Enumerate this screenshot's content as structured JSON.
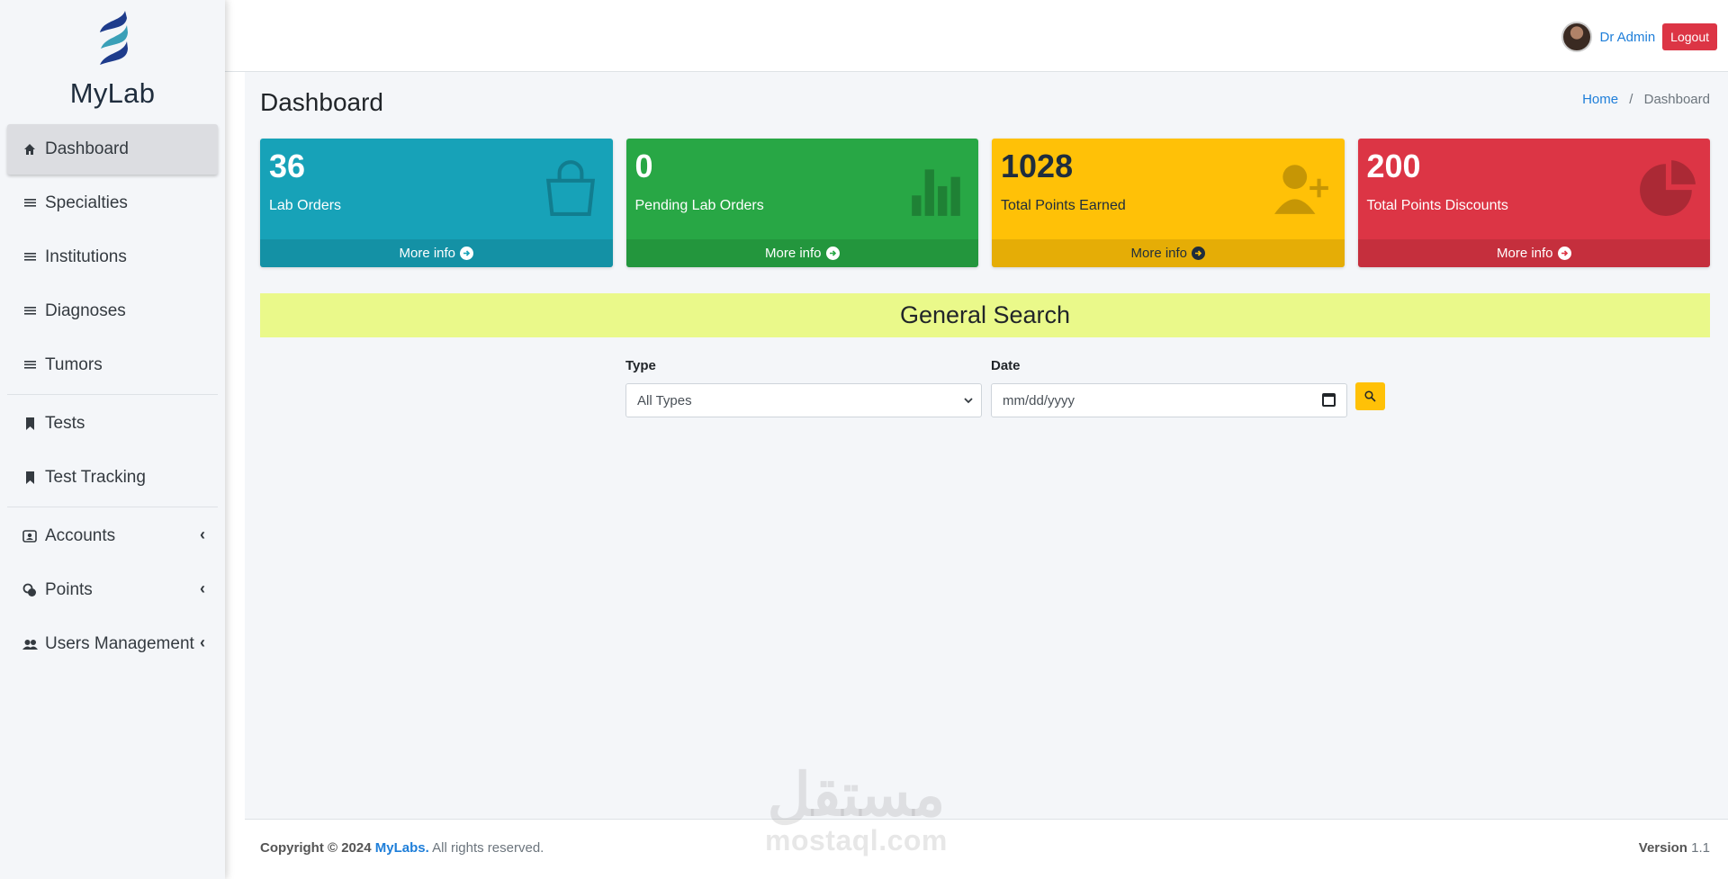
{
  "brand": {
    "name": "MyLab"
  },
  "sidebar": {
    "items": [
      {
        "label": "Dashboard",
        "icon": "home-icon",
        "active": true
      },
      {
        "label": "Specialties",
        "icon": "list-icon"
      },
      {
        "label": "Institutions",
        "icon": "list-icon"
      },
      {
        "label": "Diagnoses",
        "icon": "list-icon"
      },
      {
        "label": "Tumors",
        "icon": "list-icon"
      },
      {
        "label": "Tests",
        "icon": "bookmark-icon"
      },
      {
        "label": "Test Tracking",
        "icon": "bookmark-icon"
      },
      {
        "label": "Accounts",
        "icon": "id-card-icon",
        "expandable": true
      },
      {
        "label": "Points",
        "icon": "coins-icon",
        "expandable": true
      },
      {
        "label": "Users Management",
        "icon": "users-icon",
        "expandable": true
      }
    ]
  },
  "topbar": {
    "user_name": "Dr Admin",
    "logout_label": "Logout"
  },
  "page": {
    "title": "Dashboard"
  },
  "breadcrumb": {
    "home": "Home",
    "separator": "/",
    "current": "Dashboard"
  },
  "stats": [
    {
      "value": "36",
      "label": "Lab Orders",
      "more": "More info",
      "color": "#17a2b8",
      "icon": "shopping-bag-icon"
    },
    {
      "value": "0",
      "label": "Pending Lab Orders",
      "more": "More info",
      "color": "#28a745",
      "icon": "bar-chart-icon"
    },
    {
      "value": "1028",
      "label": "Total Points Earned",
      "more": "More info",
      "color": "#ffc107",
      "icon": "user-plus-icon"
    },
    {
      "value": "200",
      "label": "Total Points Discounts",
      "more": "More info",
      "color": "#dc3545",
      "icon": "pie-chart-icon"
    }
  ],
  "search": {
    "title": "General Search",
    "type_label": "Type",
    "type_value": "All Types",
    "date_label": "Date",
    "date_placeholder": "mm/dd/yyyy"
  },
  "watermark": {
    "arabic": "مستقل",
    "latin": "mostaql.com"
  },
  "footer": {
    "copyright_prefix": "Copyright © 2024",
    "company": "MyLabs.",
    "rights": "All rights reserved.",
    "version_label": "Version",
    "version": "1.1"
  }
}
